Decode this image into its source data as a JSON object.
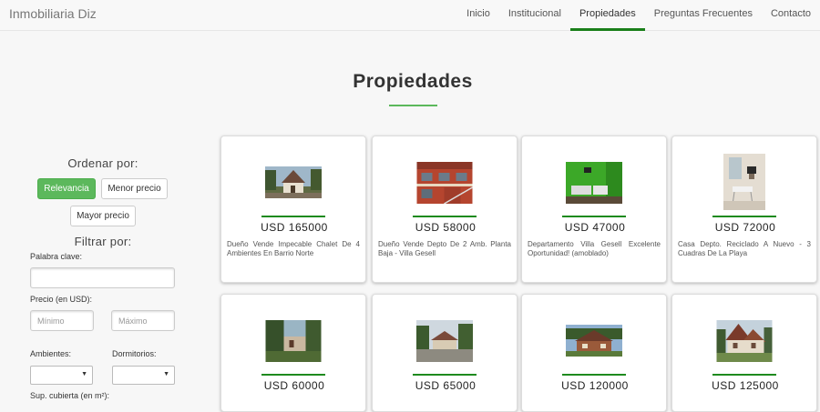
{
  "app": {
    "brand": "Inmobiliaria Diz"
  },
  "nav": {
    "items": [
      {
        "label": "Inicio"
      },
      {
        "label": "Institucional"
      },
      {
        "label": "Propiedades"
      },
      {
        "label": "Preguntas Frecuentes"
      },
      {
        "label": "Contacto"
      }
    ],
    "active": "Propiedades"
  },
  "page": {
    "title": "Propiedades"
  },
  "sidebar": {
    "order_label": "Ordenar por:",
    "order_buttons": {
      "relevance": "Relevancia",
      "lower_price": "Menor precio",
      "higher_price": "Mayor precio"
    },
    "filter_label": "Filtrar por:",
    "keyword_label": "Palabra clave:",
    "keyword_value": "",
    "price_label": "Precio (en USD):",
    "price_min_placeholder": "Mínimo",
    "price_max_placeholder": "Máximo",
    "rooms_label": "Ambientes:",
    "bedrooms_label": "Dormitorios:",
    "covered_area_label": "Sup. cubierta (en m²):"
  },
  "listings": [
    {
      "price": "USD 165000",
      "description": "Dueño Vende Impecable Chalet De 4 Ambientes En Barrio Norte",
      "image": "chalet-photo"
    },
    {
      "price": "USD 58000",
      "description": "Dueño Vende Depto De 2 Amb. Planta Baja - Villa Gesell",
      "image": "building-photo"
    },
    {
      "price": "USD 47000",
      "description": "Departamento Villa Gesell Excelente Oportunidad! (amoblado)",
      "image": "green-room-photo"
    },
    {
      "price": "USD 72000",
      "description": "Casa Depto. Reciclado A Nuevo - 3 Cuadras De La Playa",
      "image": "living-room-photo"
    },
    {
      "price": "USD 60000",
      "description": "",
      "image": "garden-house-photo"
    },
    {
      "price": "USD 65000",
      "description": "",
      "image": "street-house-photo"
    },
    {
      "price": "USD 120000",
      "description": "",
      "image": "wooden-house-photo"
    },
    {
      "price": "USD 125000",
      "description": "",
      "image": "alpine-house-photo"
    }
  ],
  "colors": {
    "accent": "#1a7f1a",
    "button_green": "#5cb85c",
    "background": "#f7f7f7"
  }
}
